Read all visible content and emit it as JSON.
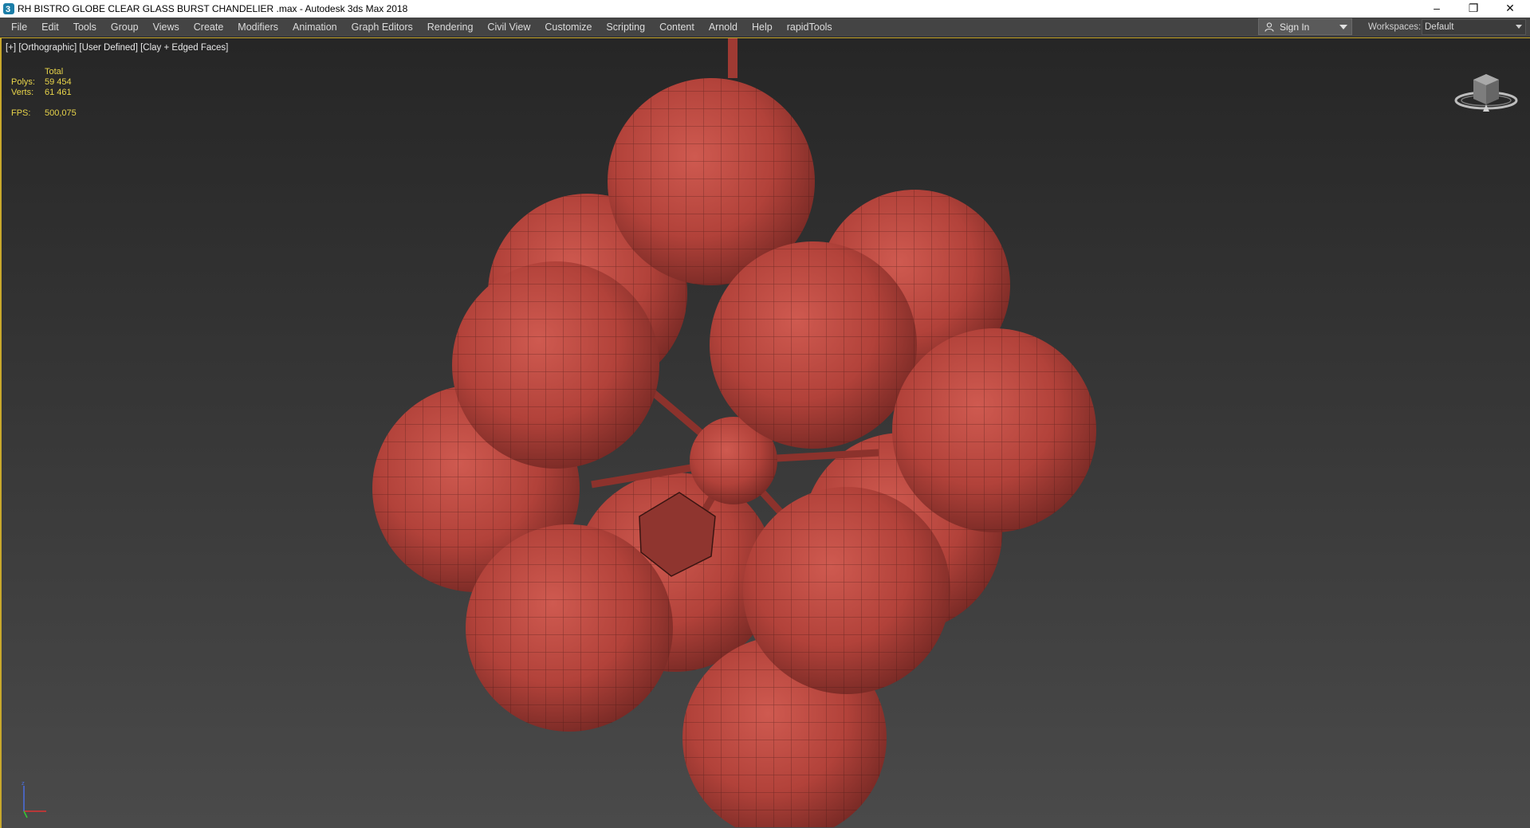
{
  "window": {
    "title": "RH BISTRO GLOBE CLEAR GLASS BURST CHANDELIER .max - Autodesk 3ds Max 2018",
    "minimize": "–",
    "restore": "❐",
    "close": "✕"
  },
  "menu": {
    "items": [
      "File",
      "Edit",
      "Tools",
      "Group",
      "Views",
      "Create",
      "Modifiers",
      "Animation",
      "Graph Editors",
      "Rendering",
      "Civil View",
      "Customize",
      "Scripting",
      "Content",
      "Arnold",
      "Help",
      "rapidTools"
    ]
  },
  "account": {
    "sign_in": "Sign In",
    "workspaces_label": "Workspaces:",
    "workspace_value": "Default"
  },
  "viewport": {
    "label_plus": "[+]",
    "label_view": "[Orthographic]",
    "label_camera": "[User Defined]",
    "label_shading": "[Clay + Edged Faces]",
    "stats": {
      "total_label": "Total",
      "polys_label": "Polys:",
      "polys_value": "59 454",
      "verts_label": "Verts:",
      "verts_value": "61 461",
      "fps_label": "FPS:",
      "fps_value": "500,075"
    },
    "model_color": "#b2423a",
    "accent_border": "#c8a82c",
    "stats_color": "#e8d44a"
  }
}
